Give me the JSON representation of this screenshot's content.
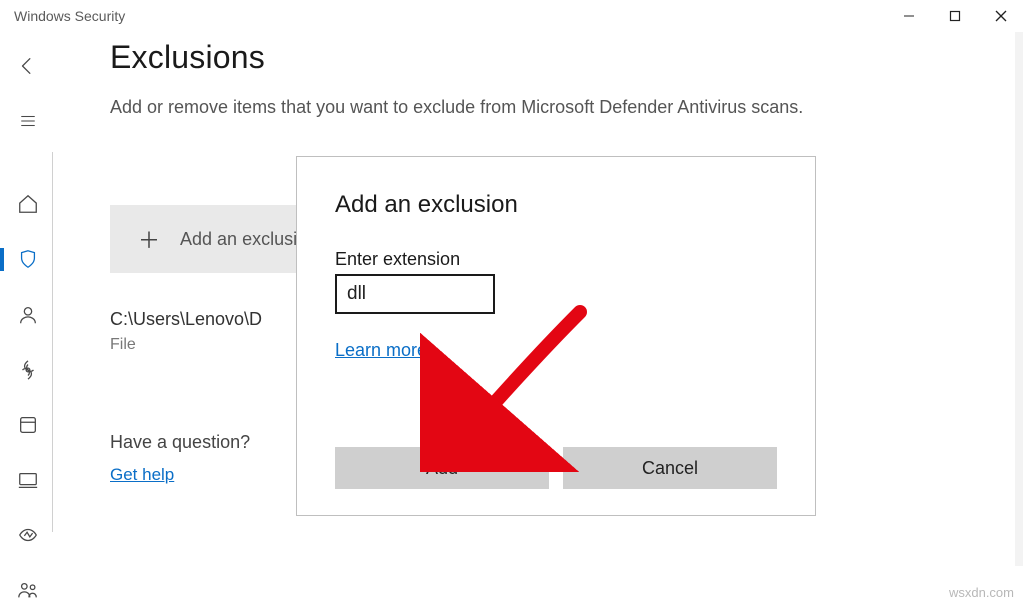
{
  "window": {
    "title": "Windows Security"
  },
  "page": {
    "title": "Exclusions",
    "description": "Add or remove items that you want to exclude from Microsoft Defender Antivirus scans."
  },
  "add_button": {
    "label": "Add an exclusion"
  },
  "exclusion_item": {
    "path": "C:\\Users\\Lenovo\\D",
    "type_label": "File"
  },
  "help": {
    "question": "Have a question?",
    "link": "Get help"
  },
  "dialog": {
    "title": "Add an exclusion",
    "field_label": "Enter extension",
    "input_value": "dll",
    "learn_more": "Learn more",
    "add_label": "Add",
    "cancel_label": "Cancel"
  },
  "watermark": "wsxdn.com"
}
